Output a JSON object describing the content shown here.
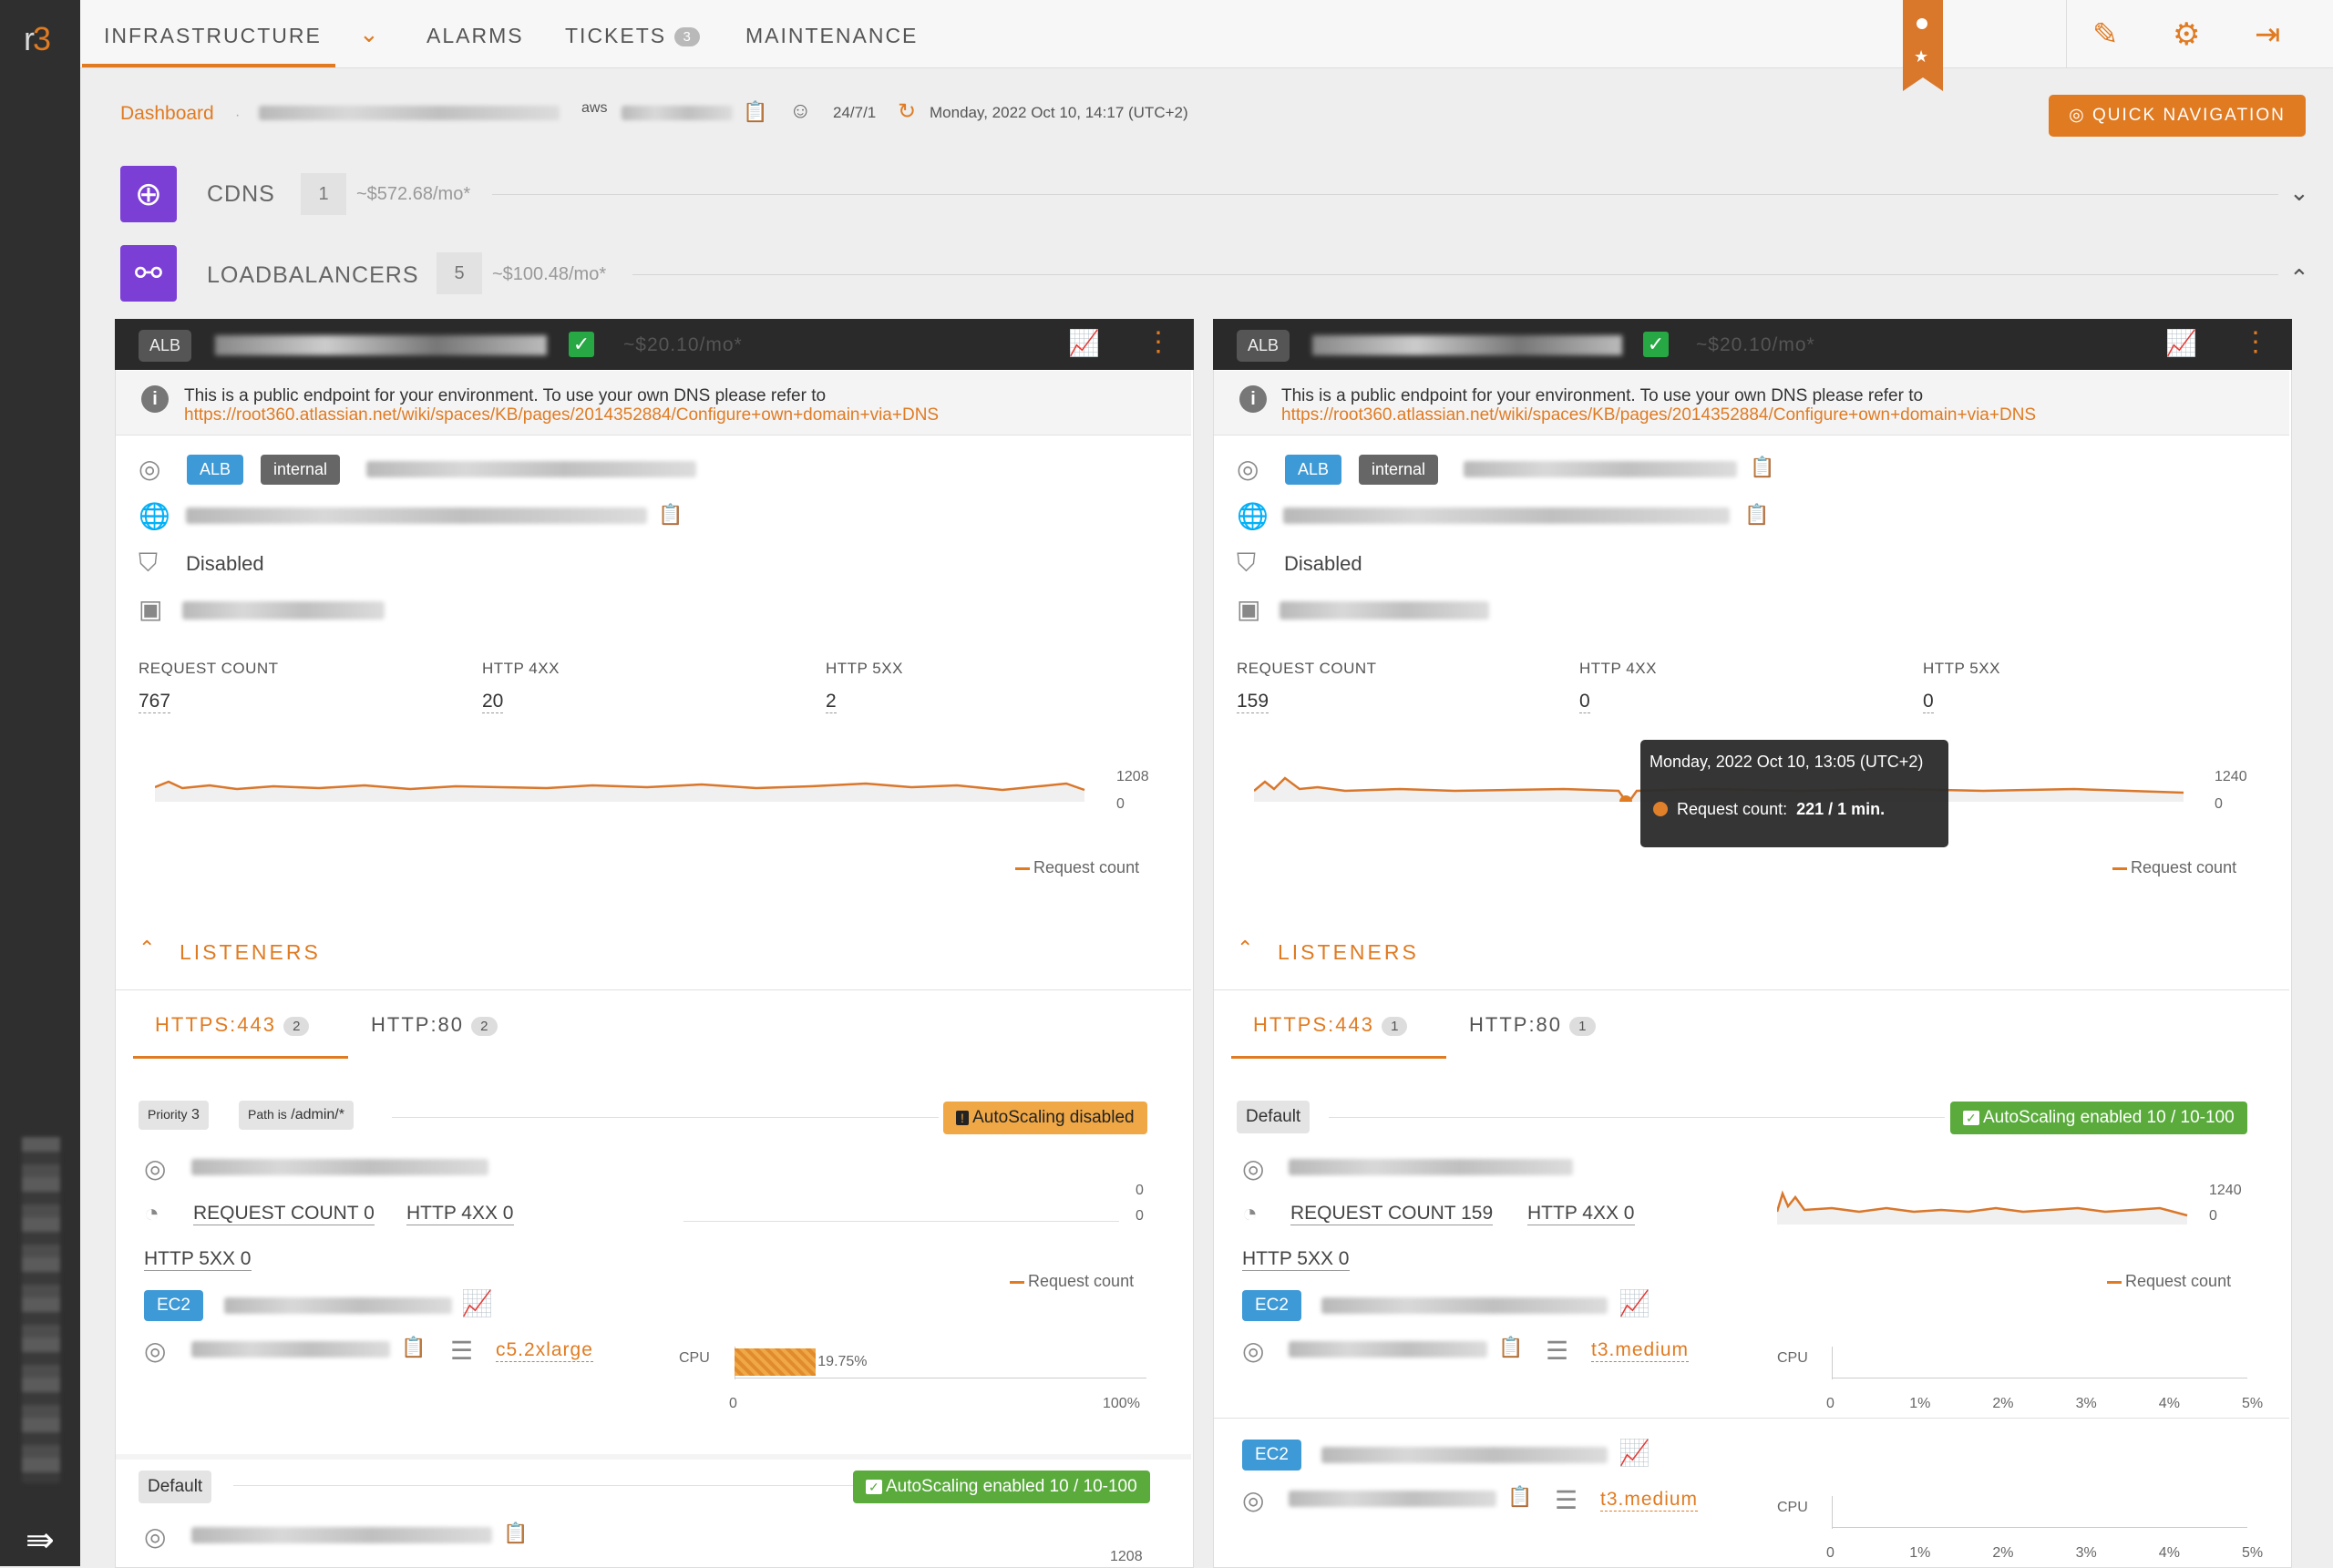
{
  "app": {
    "logo_prefix": "r",
    "logo_suffix": "3"
  },
  "nav": {
    "infrastructure": "INFRASTRUCTURE",
    "alarms": "ALARMS",
    "tickets": "TICKETS",
    "tickets_count": "3",
    "maintenance": "MAINTENANCE"
  },
  "breadcrumb": {
    "dashboard": "Dashboard",
    "cloud": "aws",
    "support": "24/7/1",
    "datetime": "Monday, 2022 Oct 10, 14:17 (UTC+2)",
    "quick_nav": "QUICK NAVIGATION"
  },
  "sections": [
    {
      "title": "CDNS",
      "count": "1",
      "cost": "~$572.68/mo*",
      "expanded": false
    },
    {
      "title": "LOADBALANCERS",
      "count": "5",
      "cost": "~$100.48/mo*",
      "expanded": true
    }
  ],
  "panels": [
    {
      "type": "ALB",
      "cost": "~$20.10/mo*",
      "info_text": "This is a public endpoint for your environment. To use your own DNS please refer to",
      "info_link": "https://root360.atlassian.net/wiki/spaces/KB/pages/2014352884/Configure+own+domain+via+DNS",
      "tag_type": "ALB",
      "tag_scheme": "internal",
      "waf": "Disabled",
      "metrics": [
        {
          "label": "REQUEST COUNT",
          "value": "767"
        },
        {
          "label": "HTTP 4XX",
          "value": "20"
        },
        {
          "label": "HTTP 5XX",
          "value": "2"
        }
      ],
      "chart_max": "1208",
      "chart_min": "0",
      "legend": "Request count",
      "listeners_label": "LISTENERS",
      "tabs": [
        {
          "label": "HTTPS:443",
          "count": "2"
        },
        {
          "label": "HTTP:80",
          "count": "2"
        }
      ],
      "rules": [
        {
          "chips": [
            "Priority",
            "3",
            "Path is",
            "/admin/*"
          ],
          "autoscaling": "AutoScaling disabled",
          "request_count": "REQUEST COUNT 0",
          "http4xx": "HTTP 4XX 0",
          "http5xx": "HTTP 5XX 0",
          "axis_top": "0",
          "axis_bottom": "0",
          "legend": "Request count",
          "ec2": "EC2",
          "instance_type": "c5.2xlarge",
          "cpu_label": "CPU",
          "cpu_value": "19.75%",
          "cpu_axis_min": "0",
          "cpu_axis_max": "100%"
        },
        {
          "chips": [
            "Default"
          ],
          "autoscaling": "AutoScaling enabled 10 / 10-100",
          "axis_top": "1208"
        }
      ]
    },
    {
      "type": "ALB",
      "cost": "~$20.10/mo*",
      "info_text": "This is a public endpoint for your environment. To use your own DNS please refer to",
      "info_link": "https://root360.atlassian.net/wiki/spaces/KB/pages/2014352884/Configure+own+domain+via+DNS",
      "tag_type": "ALB",
      "tag_scheme": "internal",
      "waf": "Disabled",
      "metrics": [
        {
          "label": "REQUEST COUNT",
          "value": "159"
        },
        {
          "label": "HTTP 4XX",
          "value": "0"
        },
        {
          "label": "HTTP 5XX",
          "value": "0"
        }
      ],
      "chart_max": "1240",
      "chart_min": "0",
      "legend": "Request count",
      "tooltip": {
        "time": "Monday, 2022 Oct 10, 13:05 (UTC+2)",
        "label": "Request count:",
        "value": "221 / 1 min."
      },
      "listeners_label": "LISTENERS",
      "tabs": [
        {
          "label": "HTTPS:443",
          "count": "1"
        },
        {
          "label": "HTTP:80",
          "count": "1"
        }
      ],
      "rules": [
        {
          "chips": [
            "Default"
          ],
          "autoscaling": "AutoScaling enabled 10 / 10-100",
          "request_count": "REQUEST COUNT 159",
          "http4xx": "HTTP 4XX 0",
          "http5xx": "HTTP 5XX 0",
          "axis_top": "1240",
          "axis_bottom": "0",
          "legend": "Request count",
          "ec2": "EC2",
          "instance_type": "t3.medium",
          "cpu_label": "CPU",
          "cpu_ticks": [
            "0",
            "1%",
            "2%",
            "3%",
            "4%",
            "5%"
          ]
        },
        {
          "ec2": "EC2",
          "instance_type": "t3.medium",
          "cpu_label": "CPU",
          "cpu_ticks": [
            "0",
            "1%",
            "2%",
            "3%",
            "4%",
            "5%"
          ]
        }
      ]
    }
  ],
  "colors": {
    "accent": "#e07b22",
    "section": "#7b3fd6",
    "blue": "#3d9ad6",
    "green": "#5aab3c"
  }
}
